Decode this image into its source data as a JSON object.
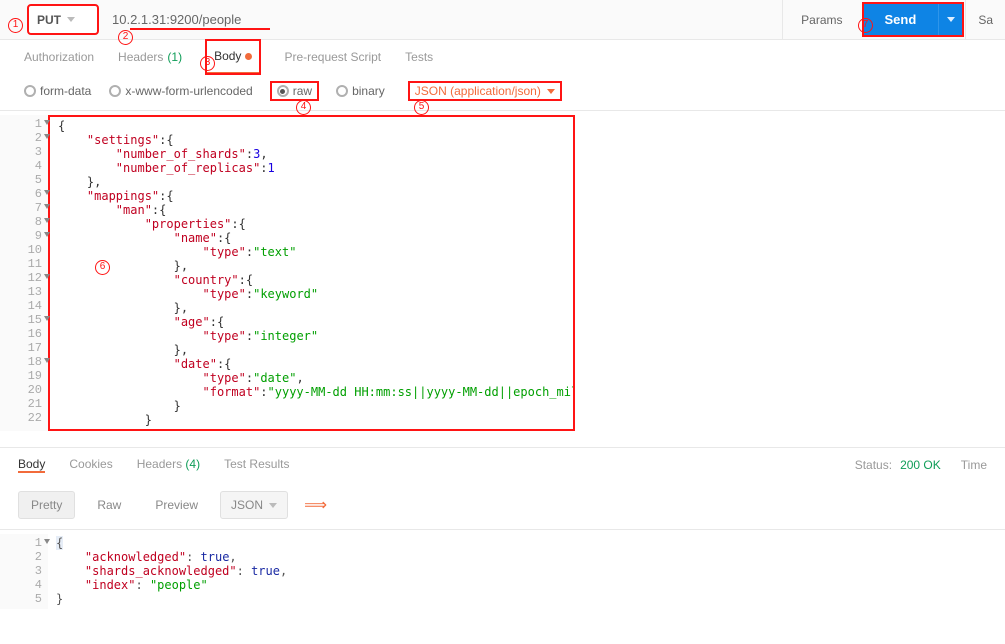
{
  "request": {
    "method": "PUT",
    "url": "10.2.1.31:9200/people",
    "params_btn": "Params",
    "send_btn": "Send",
    "save_btn": "Sa"
  },
  "req_tabs": {
    "authorization": "Authorization",
    "headers": "Headers",
    "headers_count": "(1)",
    "body": "Body",
    "prerequest": "Pre-request Script",
    "tests": "Tests"
  },
  "body_opts": {
    "formdata": "form-data",
    "urlencoded": "x-www-form-urlencoded",
    "raw": "raw",
    "binary": "binary",
    "content_type": "JSON (application/json)"
  },
  "req_body_lines": [
    "{",
    "    \"settings\":{",
    "        \"number_of_shards\":3,",
    "        \"number_of_replicas\":1",
    "    },",
    "    \"mappings\":{",
    "        \"man\":{",
    "            \"properties\":{",
    "                \"name\":{",
    "                    \"type\":\"text\"",
    "                },",
    "                \"country\":{",
    "                    \"type\":\"keyword\"",
    "                },",
    "                \"age\":{",
    "                    \"type\":\"integer\"",
    "                },",
    "                \"date\":{",
    "                    \"type\":\"date\",",
    "                    \"format\":\"yyyy-MM-dd HH:mm:ss||yyyy-MM-dd||epoch_millis\"",
    "                }",
    "            }"
  ],
  "resp_tabs": {
    "body": "Body",
    "cookies": "Cookies",
    "headers": "Headers",
    "headers_count": "(4)",
    "tests": "Test Results",
    "status_label": "Status:",
    "status_value": "200 OK",
    "time_label": "Time"
  },
  "format_opts": {
    "pretty": "Pretty",
    "raw": "Raw",
    "preview": "Preview",
    "lang": "JSON"
  },
  "resp_body_lines": [
    "{",
    "    \"acknowledged\": true,",
    "    \"shards_acknowledged\": true,",
    "    \"index\": \"people\"",
    "}"
  ],
  "annotations": {
    "a1": "1",
    "a2": "2",
    "a3": "3",
    "a4": "4",
    "a5": "5",
    "a6": "6",
    "a7": "7"
  }
}
